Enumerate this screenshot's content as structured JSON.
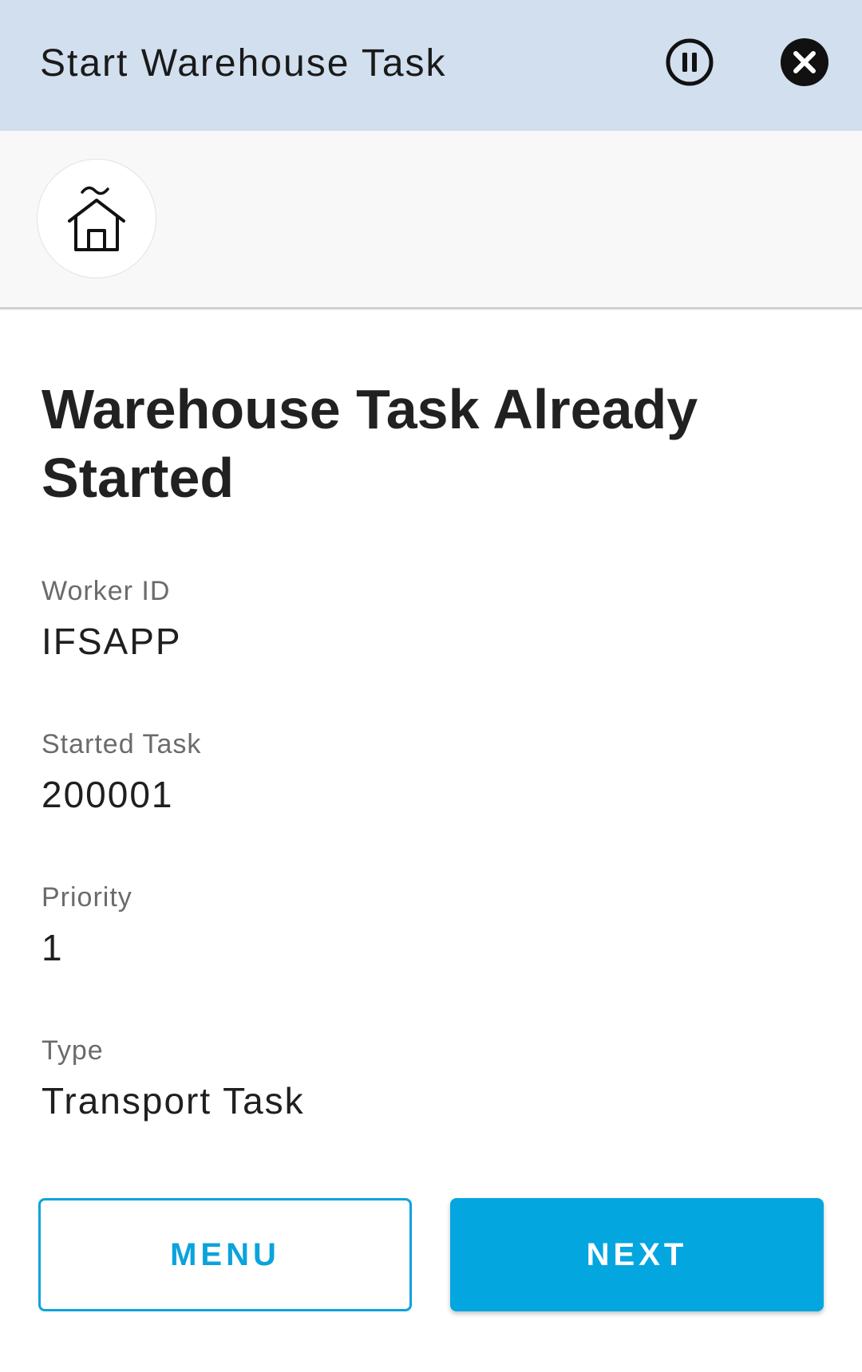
{
  "header": {
    "title": "Start Warehouse Task",
    "pause_icon": "pause-circle-icon",
    "close_icon": "close-circle-icon",
    "background": "#d1dfee"
  },
  "toolbar": {
    "home_icon": "warehouse-home-icon"
  },
  "main": {
    "title": "Warehouse Task Already Started",
    "fields": [
      {
        "label": "Worker ID",
        "value": "IFSAPP"
      },
      {
        "label": "Started Task",
        "value": "200001"
      },
      {
        "label": "Priority",
        "value": "1"
      },
      {
        "label": "Type",
        "value": "Transport Task"
      }
    ]
  },
  "actions": {
    "menu_label": "MENU",
    "next_label": "NEXT",
    "accent_color": "#03a6df"
  }
}
